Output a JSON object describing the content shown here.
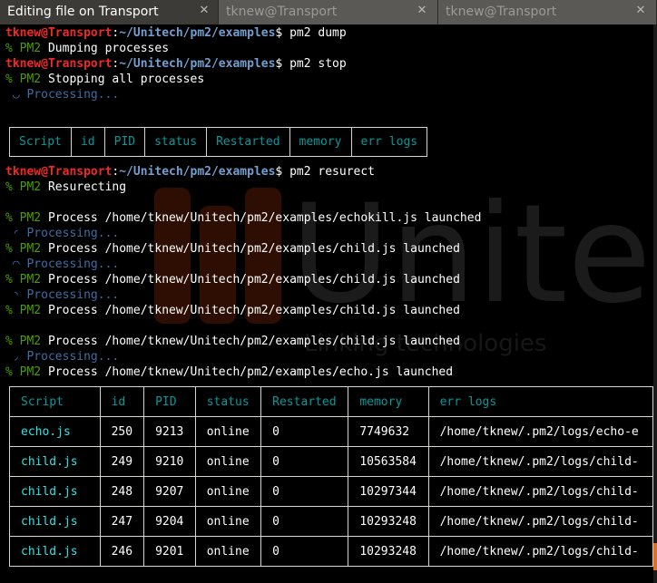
{
  "tabs": [
    {
      "title": "Editing file on Transport",
      "close": "✕",
      "active": true
    },
    {
      "title": "tknew@Transport",
      "close": "✕",
      "active": false
    },
    {
      "title": "tknew@Transport",
      "close": "✕",
      "active": false
    }
  ],
  "prompt": {
    "user": "tknew@Transport",
    "sep": ":",
    "path": "~/Unitech/pm2/examples",
    "suffix": "$"
  },
  "pm2_prefix": "% PM2",
  "lines": {
    "cmd_dump": " pm2 dump",
    "dumping": " Dumping processes",
    "cmd_stop": " pm2 stop",
    "stopping": " Stopping all processes",
    "processing": " ◡ Processing...",
    "cmd_resurect": " pm2 resurect",
    "resurecting": " Resurecting",
    "launch1": " Process /home/tknew/Unitech/pm2/examples/echokill.js launched",
    "proc1": " ◜ Processing...",
    "launch2": " Process /home/tknew/Unitech/pm2/examples/child.js launched",
    "proc2": " ◠ Processing...",
    "launch3": " Process /home/tknew/Unitech/pm2/examples/child.js launched",
    "proc3": " ◝ Processing...",
    "launch4": " Process /home/tknew/Unitech/pm2/examples/child.js launched",
    "launch5": " Process /home/tknew/Unitech/pm2/examples/child.js launched",
    "proc5": " ◞ Processing...",
    "launch6": " Process /home/tknew/Unitech/pm2/examples/echo.js launched"
  },
  "table_headers": [
    "Script",
    "id",
    "PID",
    "status",
    "Restarted",
    "memory",
    "err logs"
  ],
  "rows": [
    {
      "script": "echo.js",
      "id": "250",
      "pid": "9213",
      "status": "online",
      "restarted": "0",
      "memory": "7749632",
      "err": "/home/tknew/.pm2/logs/echo-e"
    },
    {
      "script": "child.js",
      "id": "249",
      "pid": "9210",
      "status": "online",
      "restarted": "0",
      "memory": "10563584",
      "err": "/home/tknew/.pm2/logs/child-"
    },
    {
      "script": "child.js",
      "id": "248",
      "pid": "9207",
      "status": "online",
      "restarted": "0",
      "memory": "10297344",
      "err": "/home/tknew/.pm2/logs/child-"
    },
    {
      "script": "child.js",
      "id": "247",
      "pid": "9204",
      "status": "online",
      "restarted": "0",
      "memory": "10293248",
      "err": "/home/tknew/.pm2/logs/child-"
    },
    {
      "script": "child.js",
      "id": "246",
      "pid": "9201",
      "status": "online",
      "restarted": "0",
      "memory": "10293248",
      "err": "/home/tknew/.pm2/logs/child-"
    }
  ],
  "watermark": {
    "word": "Unite",
    "tagline": "Linking technologies"
  },
  "colors": {
    "user": "#ef2929",
    "path": "#729fcf",
    "pm2": "#4e9a06",
    "header": "#06989a",
    "name": "#34e2e2"
  }
}
